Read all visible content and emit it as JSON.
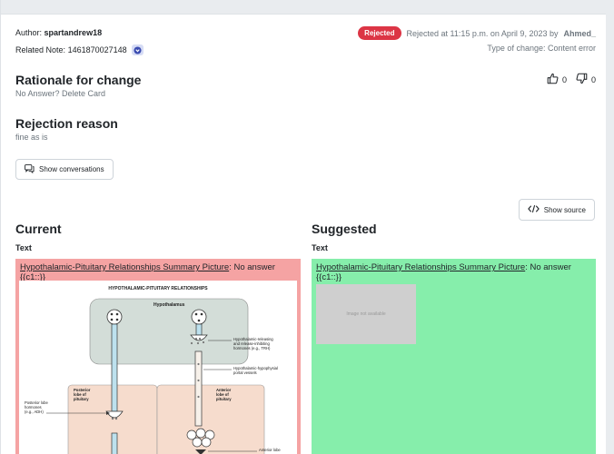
{
  "author": {
    "label": "Author:",
    "name": "spartandrew18"
  },
  "related_note": {
    "label": "Related Note:",
    "id": "1461870027148",
    "icon": "chevron-down-circle-icon"
  },
  "status": {
    "badge": "Rejected",
    "badge_color": "#dc3545",
    "text_prefix": "Rejected at 11:15 p.m. on April 9, 2023 by",
    "reviewer": "Ahmed_"
  },
  "change_type": "Type of change: Content error",
  "rationale": {
    "title": "Rationale for change",
    "text": "No Answer? Delete Card"
  },
  "votes": {
    "up_count": "0",
    "down_count": "0"
  },
  "rejection": {
    "title": "Rejection reason",
    "text": "fine as is"
  },
  "buttons": {
    "show_conversations": "Show conversations",
    "show_source": "Show source"
  },
  "current": {
    "title": "Current",
    "field_label": "Text",
    "link_text": "Hypothalamic-Pituitary Relationships Summary Picture",
    "rest_text": ": No answer {{c1::}}",
    "bg_color": "#f5a3a3",
    "diagram": {
      "title": "HYPOTHALAMIC-PITUITARY RELATIONSHIPS",
      "hypothalamus_label": "Hypothalamus",
      "label_releasing": "Hypothalamic-releasing",
      "label_inhibiting": "and release-inhibiting",
      "label_trh": "hormones (e.g., TRH)",
      "label_portal_1": "Hypothalamic-hypophysial",
      "label_portal_2": "portal vessels",
      "label_posterior_1": "Posterior",
      "label_posterior_2": "lobe of",
      "label_posterior_3": "pituitary",
      "label_post_horm_1": "Posterior lobe",
      "label_post_horm_2": "hormones",
      "label_post_horm_3": "(e.g., ADH)",
      "label_anterior_1": "Anterior",
      "label_anterior_2": "lobe of",
      "label_anterior_3": "pituitary",
      "label_anterior_lobe": "Anterior lobe"
    }
  },
  "suggested": {
    "title": "Suggested",
    "field_label": "Text",
    "link_text": "Hypothalamic-Pituitary Relationships Summary Picture",
    "rest_text": ": No answer {{c1::}}",
    "bg_color": "#86eeab",
    "image_placeholder": "Image not available"
  }
}
